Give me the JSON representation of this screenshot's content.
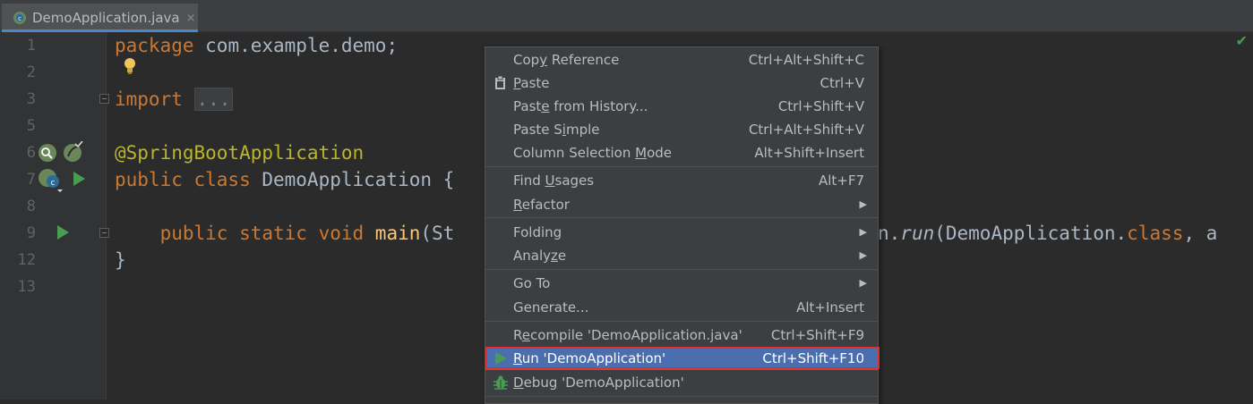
{
  "tab": {
    "title": "DemoApplication.java",
    "close": "×"
  },
  "gutter": {
    "line_numbers": [
      "1",
      "2",
      "3",
      "5",
      "6",
      "7",
      "8",
      "9",
      "12",
      "13"
    ]
  },
  "code": {
    "line1_kw": "package",
    "line1_rest": " com.example.demo;",
    "line3_kw": "import",
    "line3_fold": "...",
    "line6": "@SpringBootApplication",
    "line7_kw": "public class",
    "line7_rest": " DemoApplication {",
    "line9_kw": "    public static void",
    "line9_fn": " main",
    "line9_a": "(St",
    "line9_b": "n.",
    "line9_run": "run",
    "line9_c": "(DemoApplication.",
    "line9_class": "class",
    "line9_d": ", a",
    "line12": "}"
  },
  "menu": {
    "items": [
      {
        "label_pre": "Cop",
        "label_u": "y",
        "label_post": " Reference",
        "shortcut": "Ctrl+Alt+Shift+C"
      },
      {
        "label_pre": "",
        "label_u": "P",
        "label_post": "aste",
        "shortcut": "Ctrl+V"
      },
      {
        "label_pre": "Past",
        "label_u": "e",
        "label_post": " from History...",
        "shortcut": "Ctrl+Shift+V"
      },
      {
        "label_pre": "Paste S",
        "label_u": "i",
        "label_post": "mple",
        "shortcut": "Ctrl+Alt+Shift+V"
      },
      {
        "label_pre": "Column Selection ",
        "label_u": "M",
        "label_post": "ode",
        "shortcut": "Alt+Shift+Insert"
      },
      {
        "label_pre": "Find ",
        "label_u": "U",
        "label_post": "sages",
        "shortcut": "Alt+F7"
      },
      {
        "label_pre": "",
        "label_u": "R",
        "label_post": "efactor",
        "shortcut": ""
      },
      {
        "label_pre": "Folding",
        "label_u": "",
        "label_post": "",
        "shortcut": ""
      },
      {
        "label_pre": "Analy",
        "label_u": "z",
        "label_post": "e",
        "shortcut": ""
      },
      {
        "label_pre": "Go To",
        "label_u": "",
        "label_post": "",
        "shortcut": ""
      },
      {
        "label_pre": "Generate...",
        "label_u": "",
        "label_post": "",
        "shortcut": "Alt+Insert"
      },
      {
        "label_pre": "R",
        "label_u": "e",
        "label_post": "compile 'DemoApplication.java'",
        "shortcut": "Ctrl+Shift+F9"
      },
      {
        "label_pre": "",
        "label_u": "R",
        "label_post": "un 'DemoApplication'",
        "shortcut": "Ctrl+Shift+F10"
      },
      {
        "label_pre": "",
        "label_u": "D",
        "label_post": "ebug 'DemoApplication'",
        "shortcut": ""
      }
    ],
    "submenu_arrow": "▶"
  },
  "colors": {
    "accent": "#4b6eaf",
    "highlight_border": "#e0302d",
    "run_green": "#499c54",
    "keyword": "#cc7832",
    "annotation": "#bbb529"
  },
  "icons": {
    "paste": "clipboard-icon",
    "run": "play-icon",
    "debug": "bug-icon",
    "bulb": "lightbulb-icon",
    "check": "checkmark-icon"
  }
}
